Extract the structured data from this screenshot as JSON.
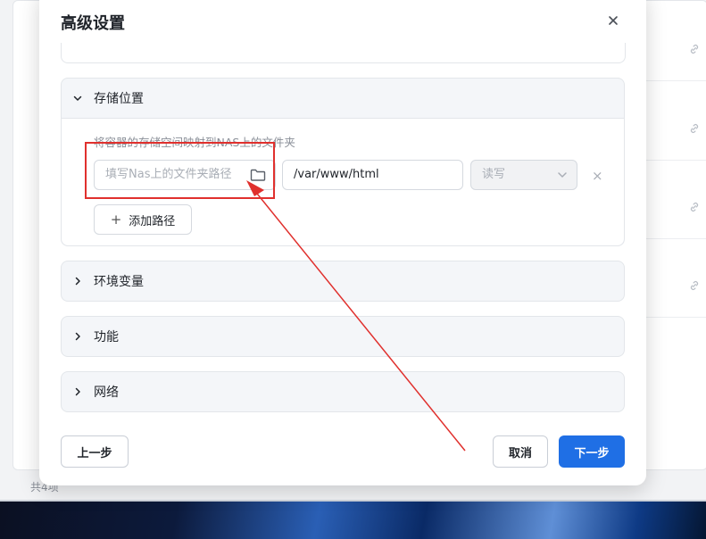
{
  "dialog": {
    "title": "高级设置",
    "close_label": "×"
  },
  "storage": {
    "title": "存储位置",
    "hint": "将容器的存储空间映射到NAS上的文件夹",
    "host_path": {
      "value": "",
      "placeholder": "填写Nas上的文件夹路径"
    },
    "container_path": {
      "value": "/var/www/html"
    },
    "permission": {
      "value": "读写"
    },
    "remove_label": "×",
    "add_path_label": "添加路径"
  },
  "sections": [
    {
      "title": "环境变量"
    },
    {
      "title": "功能"
    },
    {
      "title": "网络"
    }
  ],
  "footer": {
    "prev_label": "上一步",
    "cancel_label": "取消",
    "next_label": "下一步"
  },
  "background": {
    "footer_text": "共4项"
  },
  "colors": {
    "primary": "#1f6fe5",
    "annotation_red": "#e0302d"
  }
}
